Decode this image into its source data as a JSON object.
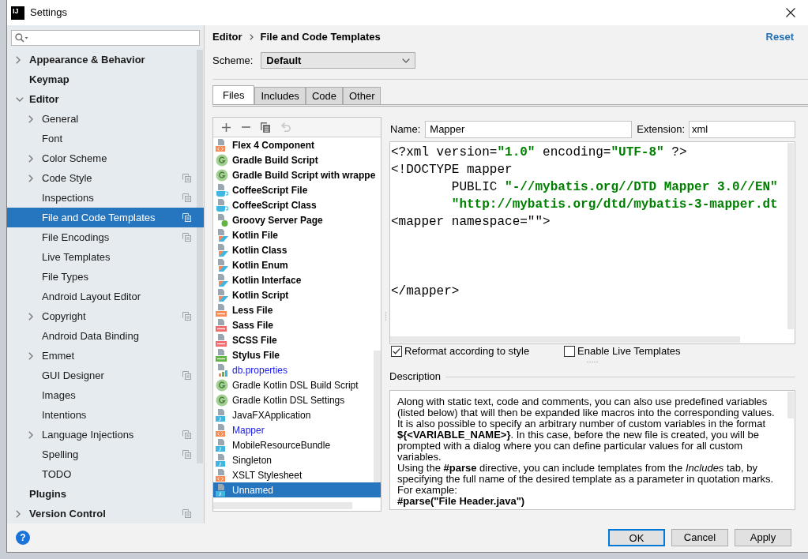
{
  "window": {
    "logo_text": "IJ",
    "title": "Settings"
  },
  "sidebar": {
    "items": [
      {
        "label": "Appearance & Behavior",
        "expandable": true,
        "expanded": false,
        "project_level": false,
        "selected": false
      },
      {
        "label": "Keymap",
        "expandable": false,
        "expanded": false,
        "project_level": false,
        "selected": false
      },
      {
        "label": "Editor",
        "expandable": true,
        "expanded": true,
        "project_level": false,
        "selected": false,
        "children": [
          {
            "label": "General",
            "expandable": true,
            "expanded": false,
            "project_level": false,
            "selected": false
          },
          {
            "label": "Font",
            "expandable": false,
            "expanded": false,
            "project_level": false,
            "selected": false
          },
          {
            "label": "Color Scheme",
            "expandable": true,
            "expanded": false,
            "project_level": false,
            "selected": false
          },
          {
            "label": "Code Style",
            "expandable": true,
            "expanded": false,
            "project_level": true,
            "selected": false
          },
          {
            "label": "Inspections",
            "expandable": false,
            "expanded": false,
            "project_level": true,
            "selected": false
          },
          {
            "label": "File and Code Templates",
            "expandable": false,
            "expanded": false,
            "project_level": true,
            "selected": true
          },
          {
            "label": "File Encodings",
            "expandable": false,
            "expanded": false,
            "project_level": true,
            "selected": false
          },
          {
            "label": "Live Templates",
            "expandable": false,
            "expanded": false,
            "project_level": false,
            "selected": false
          },
          {
            "label": "File Types",
            "expandable": false,
            "expanded": false,
            "project_level": false,
            "selected": false
          },
          {
            "label": "Android Layout Editor",
            "expandable": false,
            "expanded": false,
            "project_level": false,
            "selected": false
          },
          {
            "label": "Copyright",
            "expandable": true,
            "expanded": false,
            "project_level": true,
            "selected": false
          },
          {
            "label": "Android Data Binding",
            "expandable": false,
            "expanded": false,
            "project_level": false,
            "selected": false
          },
          {
            "label": "Emmet",
            "expandable": true,
            "expanded": false,
            "project_level": false,
            "selected": false
          },
          {
            "label": "GUI Designer",
            "expandable": false,
            "expanded": false,
            "project_level": true,
            "selected": false
          },
          {
            "label": "Images",
            "expandable": false,
            "expanded": false,
            "project_level": false,
            "selected": false
          },
          {
            "label": "Intentions",
            "expandable": false,
            "expanded": false,
            "project_level": false,
            "selected": false
          },
          {
            "label": "Language Injections",
            "expandable": true,
            "expanded": false,
            "project_level": true,
            "selected": false
          },
          {
            "label": "Spelling",
            "expandable": false,
            "expanded": false,
            "project_level": true,
            "selected": false
          },
          {
            "label": "TODO",
            "expandable": false,
            "expanded": false,
            "project_level": false,
            "selected": false
          }
        ]
      },
      {
        "label": "Plugins",
        "expandable": false,
        "expanded": false,
        "project_level": false,
        "selected": false
      },
      {
        "label": "Version Control",
        "expandable": true,
        "expanded": false,
        "project_level": true,
        "selected": false
      }
    ]
  },
  "header": {
    "breadcrumb": [
      "Editor",
      "File and Code Templates"
    ],
    "reset_link": "Reset",
    "scheme": {
      "label": "Scheme:",
      "value": "Default"
    }
  },
  "tabs": [
    {
      "label": "Files",
      "selected": true
    },
    {
      "label": "Includes",
      "selected": false
    },
    {
      "label": "Code",
      "selected": false
    },
    {
      "label": "Other",
      "selected": false
    }
  ],
  "templates": {
    "toolbar": [
      {
        "kind": "add",
        "disabled": false
      },
      {
        "kind": "remove",
        "disabled": false
      },
      {
        "kind": "copy",
        "disabled": false
      },
      {
        "kind": "reset",
        "disabled": true
      }
    ],
    "items": [
      {
        "label": "Flex 4 Component",
        "kind": "xml",
        "bold": true,
        "modified": false,
        "selected": false
      },
      {
        "label": "Gradle Build Script",
        "kind": "gradle",
        "bold": true,
        "modified": false,
        "selected": false
      },
      {
        "label": "Gradle Build Script with wrappe",
        "kind": "gradle",
        "bold": true,
        "modified": false,
        "selected": false
      },
      {
        "label": "CoffeeScript File",
        "kind": "coffee",
        "bold": true,
        "modified": false,
        "selected": false
      },
      {
        "label": "CoffeeScript Class",
        "kind": "coffee",
        "bold": true,
        "modified": false,
        "selected": false
      },
      {
        "label": "Groovy Server Page",
        "kind": "groovy",
        "bold": true,
        "modified": false,
        "selected": false
      },
      {
        "label": "Kotlin File",
        "kind": "kotlin",
        "bold": true,
        "modified": false,
        "selected": false
      },
      {
        "label": "Kotlin Class",
        "kind": "kotlin",
        "bold": true,
        "modified": false,
        "selected": false
      },
      {
        "label": "Kotlin Enum",
        "kind": "kotlin",
        "bold": true,
        "modified": false,
        "selected": false
      },
      {
        "label": "Kotlin Interface",
        "kind": "kotlin",
        "bold": true,
        "modified": false,
        "selected": false
      },
      {
        "label": "Kotlin Script",
        "kind": "kotlin",
        "bold": true,
        "modified": false,
        "selected": false
      },
      {
        "label": "Less File",
        "kind": "less",
        "bold": true,
        "modified": false,
        "selected": false
      },
      {
        "label": "Sass File",
        "kind": "sass",
        "bold": true,
        "modified": false,
        "selected": false
      },
      {
        "label": "SCSS File",
        "kind": "sass",
        "bold": true,
        "modified": false,
        "selected": false
      },
      {
        "label": "Stylus File",
        "kind": "stylus",
        "bold": true,
        "modified": false,
        "selected": false
      },
      {
        "label": "db.properties",
        "kind": "properties",
        "bold": false,
        "modified": true,
        "selected": false
      },
      {
        "label": "Gradle Kotlin DSL Build Script",
        "kind": "gradle",
        "bold": false,
        "modified": false,
        "selected": false
      },
      {
        "label": "Gradle Kotlin DSL Settings",
        "kind": "gradle",
        "bold": false,
        "modified": false,
        "selected": false
      },
      {
        "label": "JavaFXApplication",
        "kind": "java",
        "bold": false,
        "modified": false,
        "selected": false
      },
      {
        "label": "Mapper",
        "kind": "xml",
        "bold": false,
        "modified": true,
        "selected": false
      },
      {
        "label": "MobileResourceBundle",
        "kind": "java",
        "bold": false,
        "modified": false,
        "selected": false
      },
      {
        "label": "Singleton",
        "kind": "java",
        "bold": false,
        "modified": false,
        "selected": false
      },
      {
        "label": "XSLT Stylesheet",
        "kind": "xml",
        "bold": false,
        "modified": false,
        "selected": false
      },
      {
        "label": "Unnamed",
        "kind": "java",
        "bold": false,
        "modified": false,
        "selected": true
      }
    ]
  },
  "editor": {
    "name": {
      "label": "Name:",
      "value": "Mapper"
    },
    "extension": {
      "label": "Extension:",
      "value": "xml"
    },
    "code_lines": [
      {
        "kind": "code",
        "indented": false,
        "segments": [
          {
            "kind": "markup",
            "text": "<?xml version="
          },
          {
            "kind": "string",
            "text": "\"1.0\""
          },
          {
            "kind": "markup",
            "text": " encoding="
          },
          {
            "kind": "string",
            "text": "\"UTF-8\""
          },
          {
            "kind": "markup",
            "text": " ?>"
          }
        ]
      },
      {
        "kind": "code",
        "indented": false,
        "segments": [
          {
            "kind": "markup",
            "text": "<!DOCTYPE mapper"
          }
        ]
      },
      {
        "kind": "code",
        "indented": true,
        "segments": [
          {
            "kind": "markup",
            "text": "PUBLIC "
          },
          {
            "kind": "string",
            "text": "\"-//mybatis.org//DTD Mapper 3.0//EN\""
          }
        ]
      },
      {
        "kind": "code",
        "indented": true,
        "segments": [
          {
            "kind": "string",
            "text": "\"http://mybatis.org/dtd/mybatis-3-mapper.dt"
          }
        ]
      },
      {
        "kind": "code",
        "indented": false,
        "segments": [
          {
            "kind": "markup",
            "text": "<mapper namespace=\"\">"
          }
        ]
      },
      {
        "kind": "blank"
      },
      {
        "kind": "blank"
      },
      {
        "kind": "blank"
      },
      {
        "kind": "code",
        "indented": false,
        "segments": [
          {
            "kind": "markup",
            "text": "</mapper>"
          }
        ]
      }
    ],
    "options": [
      {
        "label": "Reformat according to style",
        "checked": true
      },
      {
        "label": "Enable Live Templates",
        "checked": false
      }
    ]
  },
  "description": {
    "label": "Description",
    "paragraphs": [
      {
        "kind": "text",
        "text": "Along with static text, code and comments, you can also use predefined variables (listed below) that will then be expanded like macros into the corresponding values."
      },
      {
        "kind": "text",
        "text": "It is also possible to specify an arbitrary number of custom variables in the format **${<VARIABLE_NAME>}**. In this case, before the new file is created, you will be prompted with a dialog where you can define particular values for all custom variables."
      },
      {
        "kind": "text",
        "text": "Using the **#parse** directive, you can include templates from the *Includes* tab, by specifying the full name of the desired template as a parameter in quotation marks."
      },
      {
        "kind": "text",
        "text": "For example:"
      },
      {
        "kind": "example",
        "text": "#parse(\"File Header.java\")"
      }
    ]
  },
  "footer": {
    "help": "?",
    "buttons": [
      {
        "label": "OK",
        "default": true
      },
      {
        "label": "Cancel",
        "default": false
      },
      {
        "label": "Apply",
        "default": false
      }
    ]
  }
}
